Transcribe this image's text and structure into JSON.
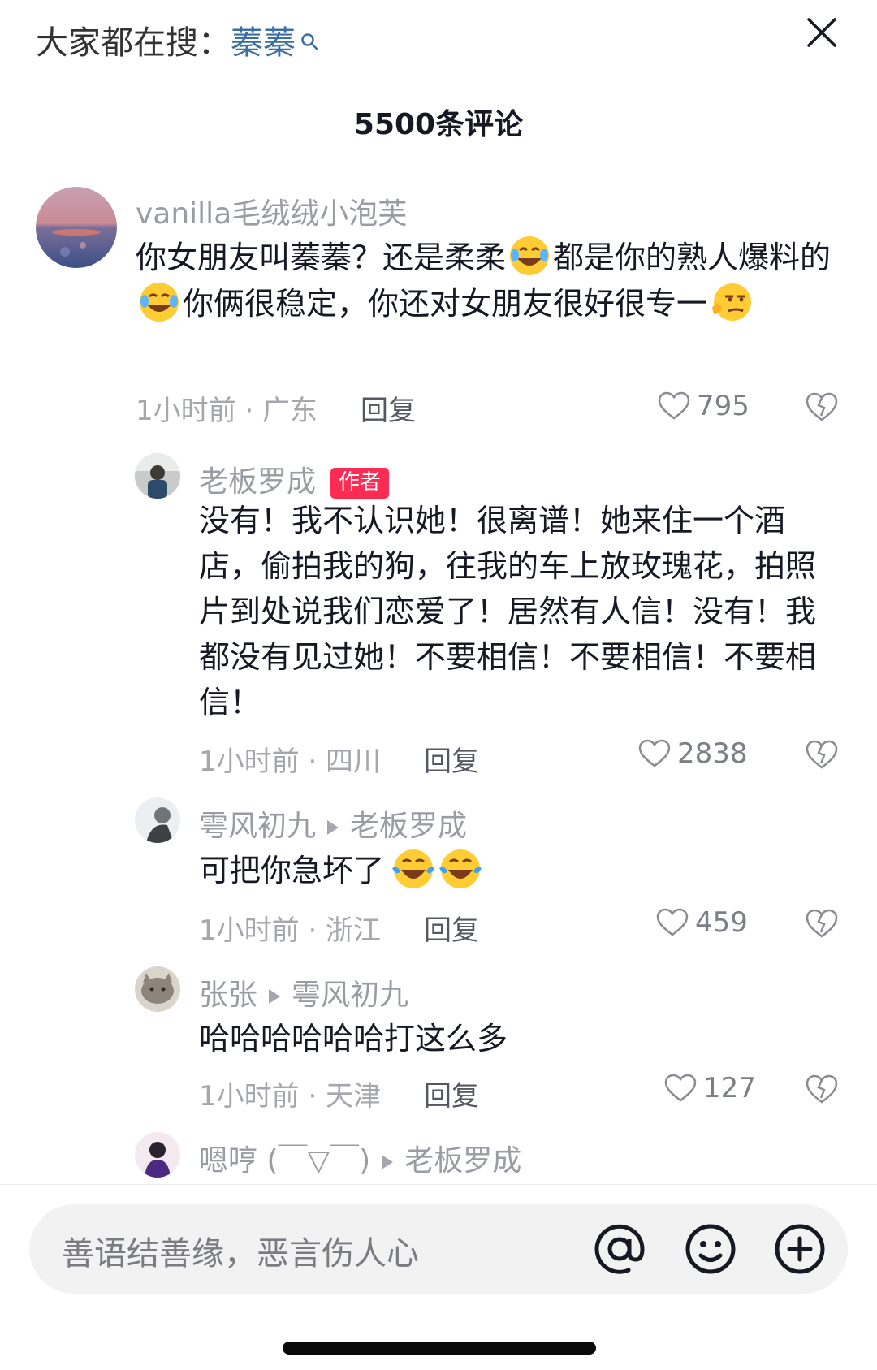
{
  "top_bar": {
    "search_prefix": "大家都在搜：",
    "search_keyword": "蓁蓁",
    "magnifier_icon": "search-icon",
    "close_icon": "close-icon"
  },
  "comment_count_title": "5500条评论",
  "comments": [
    {
      "username": "vanilla毛绒绒小泡芙",
      "text_parts": [
        "你女朋友叫蓁蓁？还是柔柔",
        "都是你的熟人爆料的",
        "你俩很稳定，你还对女朋友很好很专一",
        ""
      ],
      "emojis": [
        "laugh-cry-emoji",
        "laugh-cry-emoji",
        "smirk-emoji"
      ],
      "time_location": "1小时前 · 广东",
      "reply_label": "回复",
      "likes": "795"
    },
    {
      "username": "老板罗成",
      "badge": "作者",
      "text": "没有！我不认识她！很离谱！她来住一个酒店，偷拍我的狗，往我的车上放玫瑰花，拍照片到处说我们恋爱了！居然有人信！没有！我都没有见过她！不要相信！不要相信！不要相信！",
      "time_location": "1小时前 · 四川",
      "reply_label": "回复",
      "likes": "2838"
    },
    {
      "username": "雩风初九",
      "reply_to": "老板罗成",
      "text": "可把你急坏了",
      "emojis": [
        "laugh-cry-emoji",
        "laugh-cry-emoji"
      ],
      "time_location": "1小时前 · 浙江",
      "reply_label": "回复",
      "likes": "459"
    },
    {
      "username": "张张",
      "reply_to": "雩风初九",
      "text": "哈哈哈哈哈哈打这么多",
      "time_location": "1小时前 · 天津",
      "reply_label": "回复",
      "likes": "127"
    },
    {
      "username": "嗯哼 (￣▽￣)",
      "reply_to": "老板罗成"
    }
  ],
  "input_bar": {
    "placeholder": "善语结善缘，恶言伤人心",
    "icons": [
      "at-icon",
      "emoji-icon",
      "plus-icon"
    ]
  },
  "colors": {
    "keyword": "#3a6fa3",
    "badge": "#fe2c55",
    "meta_gray": "#a5a7ad",
    "username_gray": "#9a9ca3"
  }
}
